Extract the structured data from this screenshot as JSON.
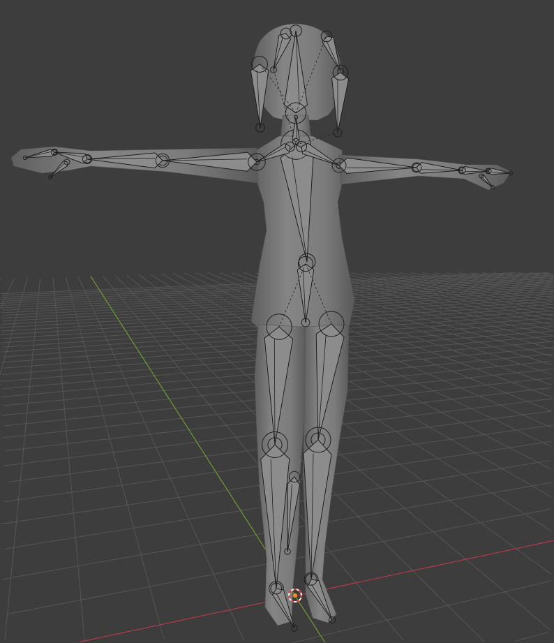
{
  "viewport": {
    "background": "#3d3d3d",
    "grid_color": "#555555",
    "x_axis_color": "#b43a4e",
    "y_axis_color": "#6f9d2a",
    "mesh_color": "#7b7b7b",
    "bone_color": "#8c8c8c",
    "cursor_colors": [
      "#e03030",
      "#ffffff",
      "#f09020"
    ]
  }
}
